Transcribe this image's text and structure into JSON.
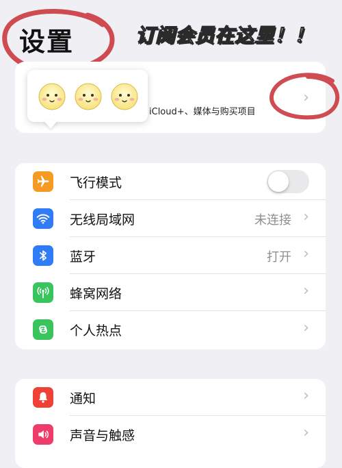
{
  "header": {
    "title": "设置",
    "annotation": "订阅会员在这里！！"
  },
  "account": {
    "subtitle": "iCloud+、媒体与购买项目"
  },
  "group1": {
    "items": [
      {
        "label": "飞行模式",
        "value": "",
        "icon": "airplane-icon",
        "color": "#f59a23"
      },
      {
        "label": "无线局域网",
        "value": "未连接",
        "icon": "wifi-icon",
        "color": "#2f7cf6"
      },
      {
        "label": "蓝牙",
        "value": "打开",
        "icon": "bluetooth-icon",
        "color": "#2f7cf6"
      },
      {
        "label": "蜂窝网络",
        "value": "",
        "icon": "cellular-icon",
        "color": "#3ac45e"
      },
      {
        "label": "个人热点",
        "value": "",
        "icon": "hotspot-icon",
        "color": "#3ac45e"
      }
    ]
  },
  "group2": {
    "items": [
      {
        "label": "通知",
        "icon": "bell-icon",
        "color": "#ef4135"
      },
      {
        "label": "声音与触感",
        "icon": "speaker-icon",
        "color": "#ef3d6b"
      }
    ]
  },
  "chevron": "›",
  "colors": {
    "background": "#efeff4",
    "annotation_fill": "#fff9c8",
    "marker_red": "#c8343a"
  }
}
